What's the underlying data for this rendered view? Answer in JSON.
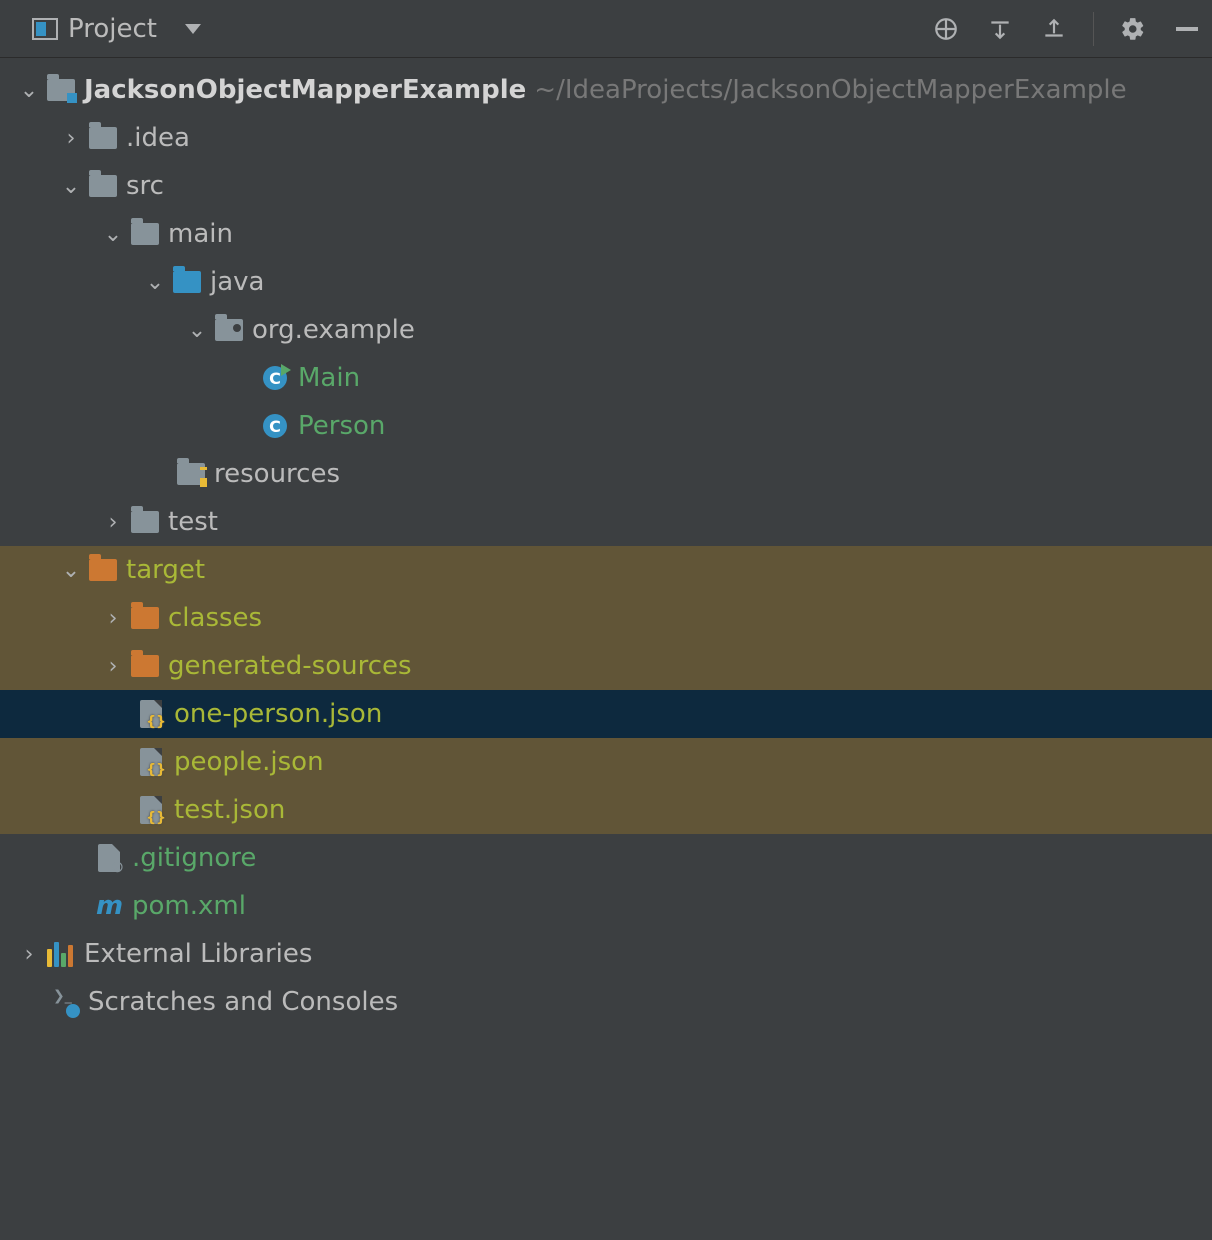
{
  "header": {
    "title": "Project"
  },
  "tree": {
    "root_name": "JacksonObjectMapperExample",
    "root_path": "~/IdeaProjects/JacksonObjectMapperExample",
    "idea_folder": ".idea",
    "src_folder": "src",
    "main_folder": "main",
    "java_folder": "java",
    "package_name": "org.example",
    "class_main": "Main",
    "class_person": "Person",
    "resources_folder": "resources",
    "test_folder": "test",
    "target_folder": "target",
    "classes_folder": "classes",
    "generated_folder": "generated-sources",
    "file_one_person": "one-person.json",
    "file_people": "people.json",
    "file_test": "test.json",
    "gitignore": ".gitignore",
    "pom": "pom.xml",
    "external_libs": "External Libraries",
    "scratches": "Scratches and Consoles"
  }
}
